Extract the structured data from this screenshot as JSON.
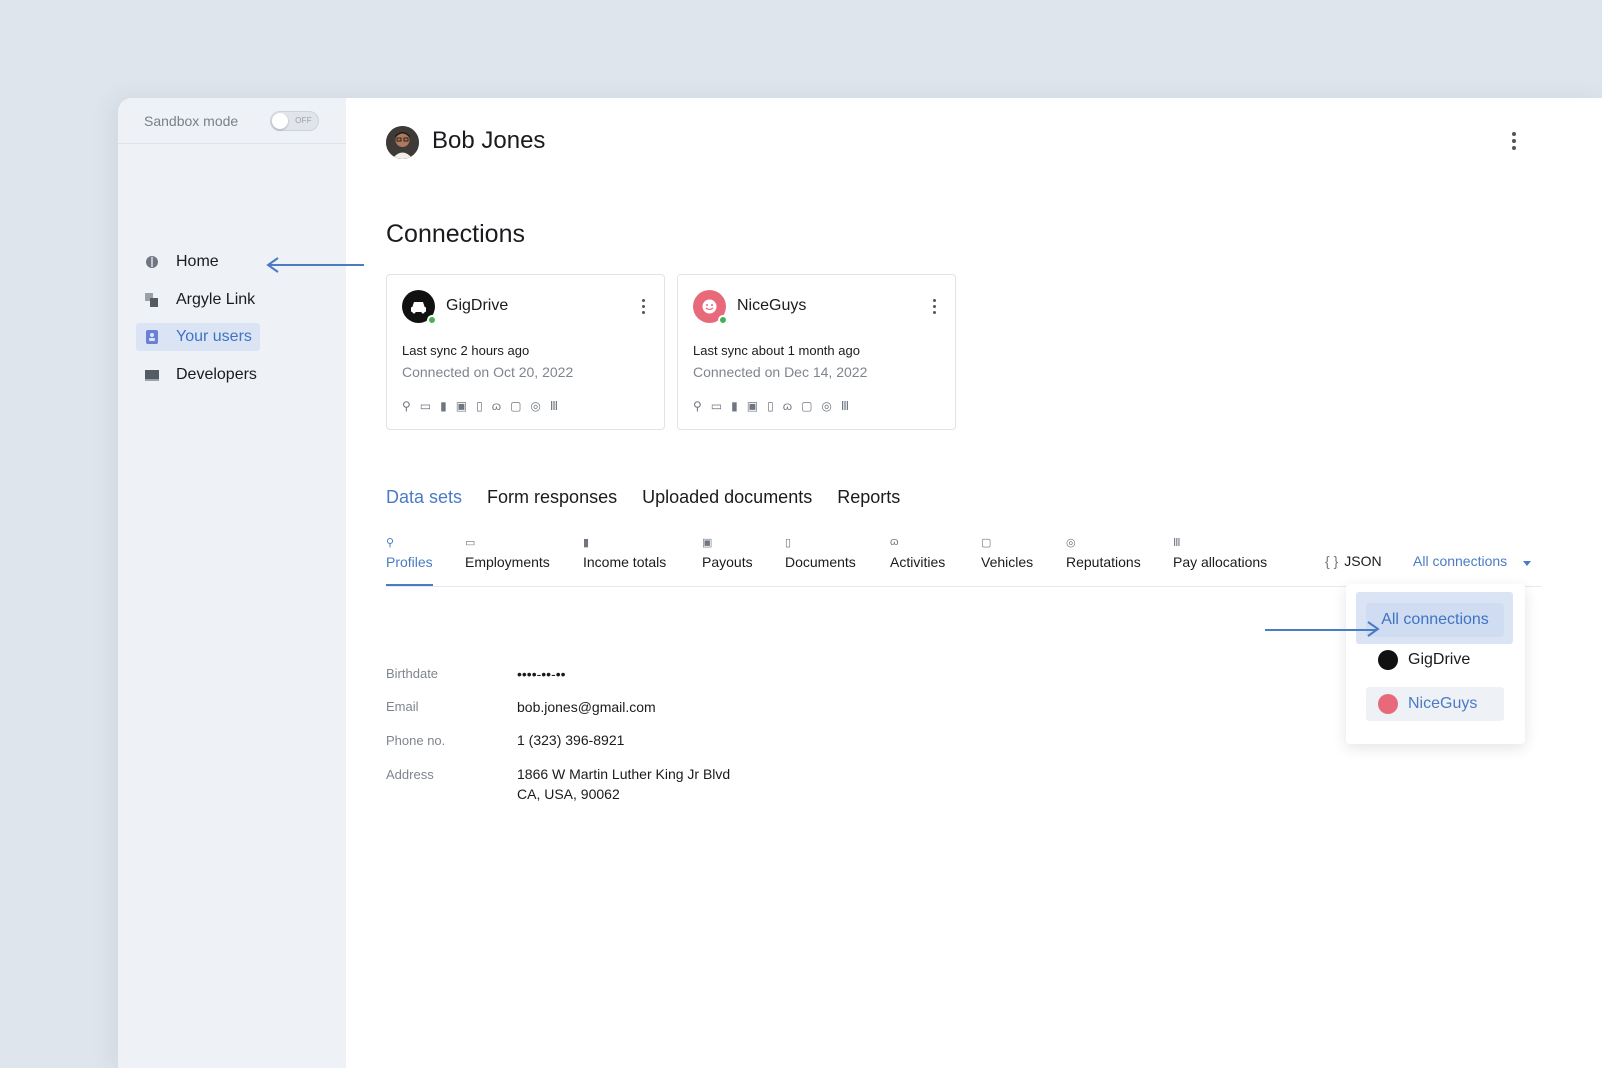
{
  "sidebar": {
    "sandbox_label": "Sandbox mode",
    "sandbox_state": "OFF",
    "items": [
      {
        "label": "Home",
        "icon": "home-icon"
      },
      {
        "label": "Argyle Link",
        "icon": "link-icon"
      },
      {
        "label": "Your users",
        "icon": "users-icon",
        "active": true
      },
      {
        "label": "Developers",
        "icon": "laptop-icon"
      }
    ]
  },
  "header": {
    "user_name": "Bob Jones"
  },
  "connections": {
    "title": "Connections",
    "cards": [
      {
        "name": "GigDrive",
        "last_sync": "Last sync 2 hours ago",
        "connected": "Connected on Oct 20, 2022",
        "logo_color": "#111111",
        "status_color": "#42b35a"
      },
      {
        "name": "NiceGuys",
        "last_sync": "Last sync about 1 month ago",
        "connected": "Connected on Dec 14, 2022",
        "logo_color": "#e86a7a",
        "status_color": "#42b35a"
      }
    ],
    "dataset_icons": [
      "profile-icon",
      "briefcase-icon",
      "bar-chart-icon",
      "money-icon",
      "document-icon",
      "bicycle-icon",
      "car-icon",
      "badge-icon",
      "bank-icon"
    ]
  },
  "tabs": [
    "Data sets",
    "Form responses",
    "Uploaded documents",
    "Reports"
  ],
  "data_tabs": [
    {
      "label": "Profiles",
      "icon": "profile-icon",
      "active": true
    },
    {
      "label": "Employments",
      "icon": "briefcase-icon"
    },
    {
      "label": "Income totals",
      "icon": "bar-chart-icon"
    },
    {
      "label": "Payouts",
      "icon": "money-icon"
    },
    {
      "label": "Documents",
      "icon": "document-icon"
    },
    {
      "label": "Activities",
      "icon": "bicycle-icon"
    },
    {
      "label": "Vehicles",
      "icon": "car-icon"
    },
    {
      "label": "Reputations",
      "icon": "badge-icon"
    },
    {
      "label": "Pay allocations",
      "icon": "bank-icon"
    }
  ],
  "toolbar": {
    "json_label": "JSON",
    "filter_label": "All connections"
  },
  "dropdown": {
    "options": [
      {
        "label": "All connections"
      },
      {
        "label": "GigDrive",
        "logo_color": "#111111"
      },
      {
        "label": "NiceGuys",
        "logo_color": "#e86a7a"
      }
    ]
  },
  "profile": {
    "fields": [
      {
        "label": "Birthdate",
        "value": "••••-••-••"
      },
      {
        "label": "Email",
        "value": "bob.jones@gmail.com"
      },
      {
        "label": "Phone no.",
        "value": "1 (323) 396-8921"
      },
      {
        "label": "Address",
        "value": "1866 W Martin Luther King Jr Blvd",
        "value2": "CA, USA, 90062"
      }
    ]
  },
  "colors": {
    "accent": "#4a7bc5",
    "active_bg": "#dbe4f4",
    "status_online": "#42b35a"
  }
}
